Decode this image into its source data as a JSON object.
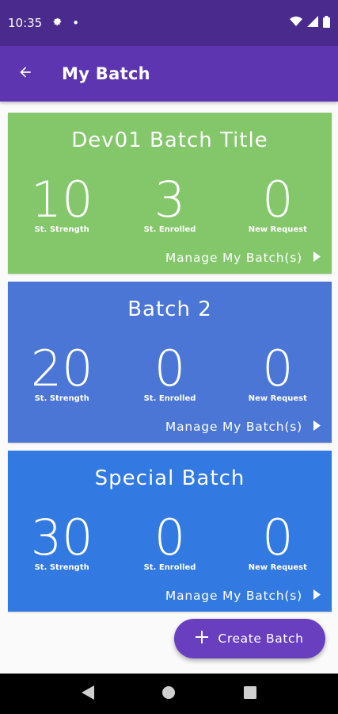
{
  "status_bar": {
    "time": "10:35",
    "dot": "•"
  },
  "app_bar": {
    "title": "My Batch"
  },
  "batches": [
    {
      "title": "Dev01 Batch Title",
      "color": "#84c76b",
      "stats": [
        {
          "value": "10",
          "label": "St. Strength"
        },
        {
          "value": "3",
          "label": "St. Enrolled"
        },
        {
          "value": "0",
          "label": "New Request"
        }
      ],
      "manage_label": "Manage My Batch(s)"
    },
    {
      "title": "Batch 2",
      "color": "#4b76d6",
      "stats": [
        {
          "value": "20",
          "label": "St. Strength"
        },
        {
          "value": "0",
          "label": "St. Enrolled"
        },
        {
          "value": "0",
          "label": "New Request"
        }
      ],
      "manage_label": "Manage My Batch(s)"
    },
    {
      "title": "Special Batch",
      "color": "#3379e2",
      "stats": [
        {
          "value": "30",
          "label": "St. Strength"
        },
        {
          "value": "0",
          "label": "St. Enrolled"
        },
        {
          "value": "0",
          "label": "New Request"
        }
      ],
      "manage_label": "Manage My Batch(s)"
    }
  ],
  "fab": {
    "label": "Create Batch",
    "icon": "plus-icon"
  },
  "colors": {
    "status_bar": "#4a2a8c",
    "app_bar": "#5e35b1",
    "fab": "#6a3fbf",
    "background": "#fafafa"
  }
}
